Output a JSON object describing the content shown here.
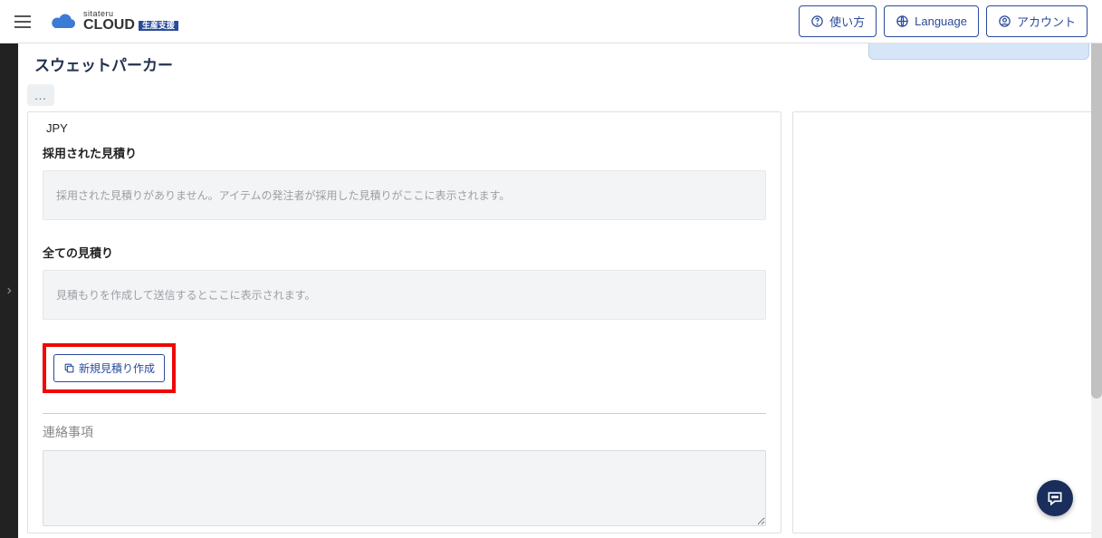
{
  "header": {
    "logo_small": "sitateru",
    "logo_main": "CLOUD",
    "logo_badge": "生産支援",
    "buttons": {
      "howto": "使い方",
      "language": "Language",
      "account": "アカウント"
    }
  },
  "page": {
    "title": "スウェットパーカー",
    "currency": "JPY",
    "sections": {
      "adopted_label": "採用された見積り",
      "adopted_placeholder": "採用された見積りがありません。アイテムの発注者が採用した見積りがここに表示されます。",
      "all_label": "全ての見積り",
      "all_placeholder": "見積もりを作成して送信するとここに表示されます。",
      "create_button": "新規見積り作成",
      "notes_label": "連絡事項"
    }
  },
  "icons": {
    "menu": "menu-icon",
    "help": "help-circle-icon",
    "globe": "globe-icon",
    "user": "user-circle-icon",
    "chevron_right": "chevron-right-icon",
    "copy": "copy-icon",
    "chat": "chat-icon",
    "kebab": "…"
  }
}
